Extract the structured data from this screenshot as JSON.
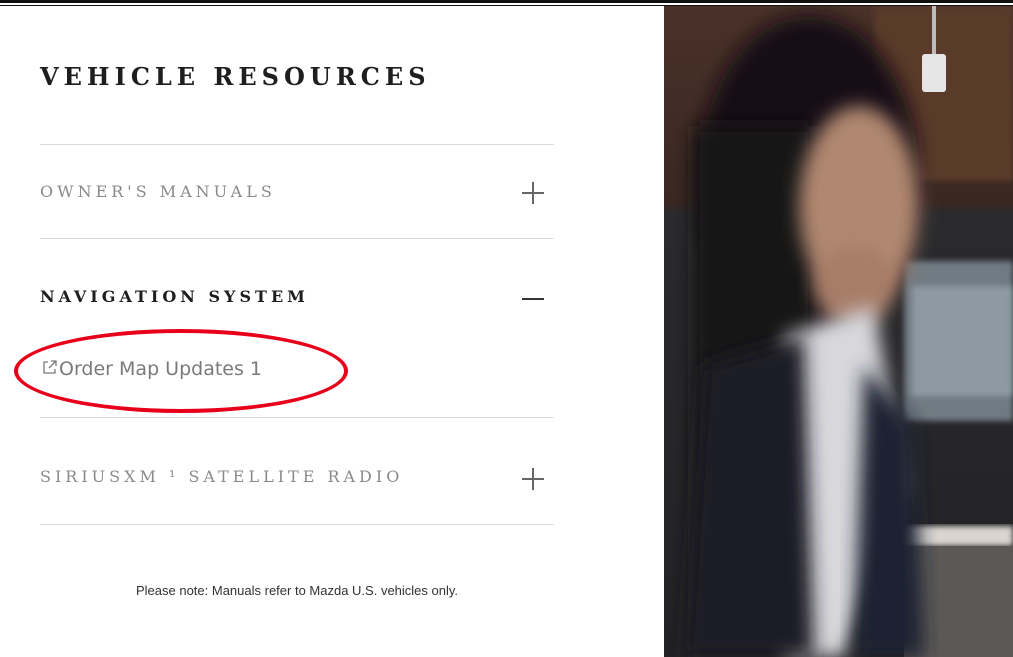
{
  "section": {
    "title": "VEHICLE RESOURCES",
    "items": [
      {
        "label": "OWNER'S MANUALS",
        "state": "collapsed",
        "toggle": "+"
      },
      {
        "label": "NAVIGATION SYSTEM",
        "state": "expanded",
        "toggle": "−",
        "links": [
          {
            "text": "Order Map Updates 1"
          }
        ]
      },
      {
        "label": "SIRIUSXM ¹ SATELLITE RADIO",
        "state": "collapsed",
        "toggle": "+"
      }
    ],
    "note": "Please note: Manuals refer to Mazda U.S. vehicles only."
  },
  "colors": {
    "annotation": "#e8001a",
    "heading": "#1e1e1e",
    "muted": "#8a8a8a"
  },
  "icons": [
    "external-link-icon",
    "plus-icon",
    "minus-icon"
  ]
}
